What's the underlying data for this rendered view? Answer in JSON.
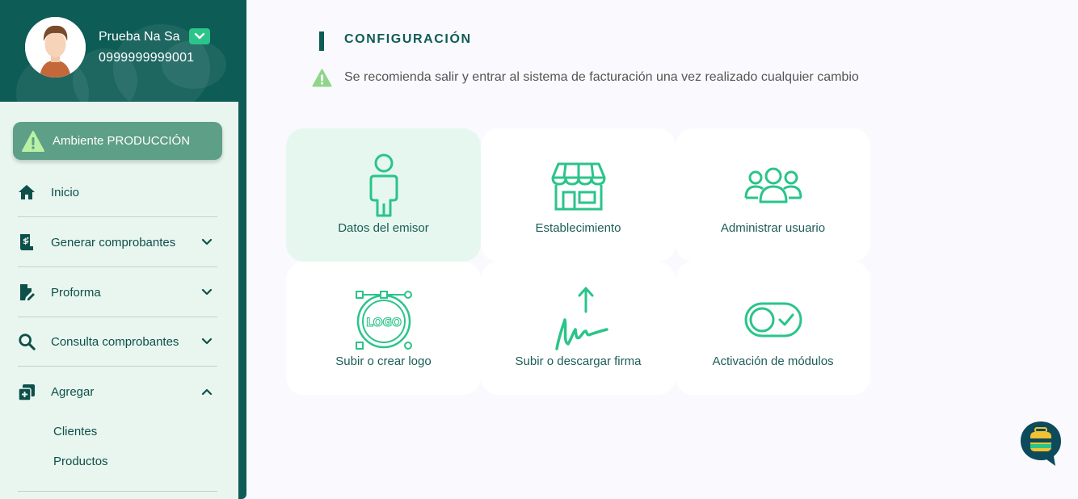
{
  "sidebar": {
    "user": {
      "name": "Prueba Na Sa",
      "id": "0999999999001"
    },
    "environment_badge": "Ambiente PRODUCCIÓN",
    "nav": [
      {
        "label": "Inicio",
        "icon": "home-icon"
      },
      {
        "label": "Generar comprobantes",
        "icon": "invoice-icon",
        "expanded": false
      },
      {
        "label": "Proforma",
        "icon": "proforma-icon",
        "expanded": false
      },
      {
        "label": "Consulta comprobantes",
        "icon": "search-icon",
        "expanded": false
      },
      {
        "label": "Agregar",
        "icon": "add-folder-icon",
        "expanded": true
      }
    ],
    "subitems": [
      "Clientes",
      "Productos"
    ]
  },
  "main": {
    "title": "CONFIGURACIÓN",
    "notice": "Se recomienda salir y entrar al sistema de facturación una vez realizado cualquier cambio",
    "cards": [
      {
        "label": "Datos del emisor",
        "icon": "person-icon",
        "active": true
      },
      {
        "label": "Establecimiento",
        "icon": "store-icon",
        "active": false
      },
      {
        "label": "Administrar usuario",
        "icon": "users-icon",
        "active": false
      },
      {
        "label": "Subir o crear logo",
        "icon": "logo-icon",
        "logo_text": "LOGO",
        "active": false
      },
      {
        "label": "Subir o descargar firma",
        "icon": "signature-icon",
        "active": false
      },
      {
        "label": "Activación de módulos",
        "icon": "toggle-icon",
        "active": false
      }
    ]
  },
  "colors": {
    "primary": "#0d5c55",
    "accent": "#2bc48a",
    "sidebar_bg": "#e8f6ef",
    "badge_bg": "#5e9f88",
    "active_card_bg": "#e6f7ef",
    "page_bg": "#faf9fd"
  }
}
